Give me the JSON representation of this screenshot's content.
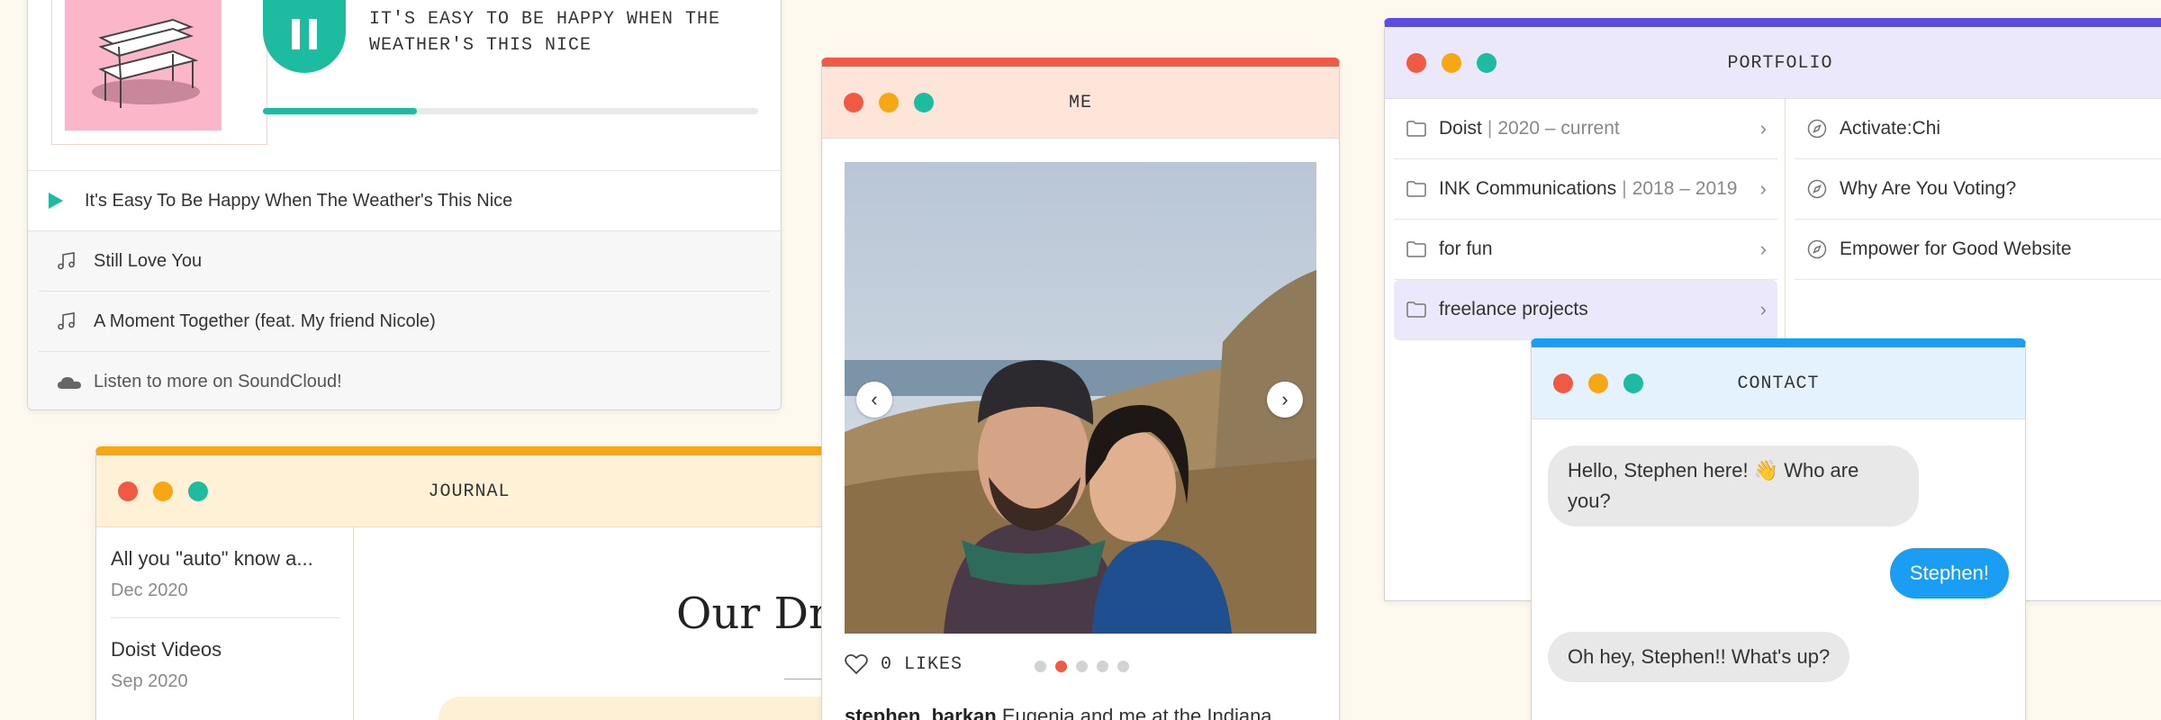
{
  "music": {
    "now_playing": "IT'S EASY TO BE HAPPY WHEN THE WEATHER'S THIS NICE",
    "progress": 0.31,
    "tracks": [
      {
        "label": "It's Easy To Be Happy When The Weather's This Nice",
        "icon": "play-icon",
        "active": true
      },
      {
        "label": "Still Love You",
        "icon": "music-note-icon"
      },
      {
        "label": "A Moment Together (feat. My friend Nicole)",
        "icon": "music-note-icon"
      }
    ],
    "soundcloud_label": "Listen to more on SoundCloud!"
  },
  "journal": {
    "title": "JOURNAL",
    "entries": [
      {
        "title": "All you \"auto\" know a...",
        "date": "Dec 2020"
      },
      {
        "title": "Doist Videos",
        "date": "Sep 2020"
      }
    ],
    "main_title": "Our Dnl"
  },
  "me": {
    "title": "ME",
    "likes": "0 LIKES",
    "pager": {
      "count": 5,
      "current": 2
    },
    "caption_user": "stephen_barkan",
    "caption_text": "Eugenia and me at the Indiana"
  },
  "portfolio": {
    "title": "PORTFOLIO",
    "folders": [
      {
        "name": "Doist",
        "sep": "|",
        "years": "2020 – current"
      },
      {
        "name": "INK Communications",
        "sep": "|",
        "years": "2018 – 2019"
      },
      {
        "name": "for fun",
        "sep": "",
        "years": ""
      },
      {
        "name": "freelance projects",
        "sep": "",
        "years": "",
        "selected": true
      }
    ],
    "projects": [
      "Activate:Chi",
      "Why Are You Voting?",
      "Empower for Good Website"
    ]
  },
  "contact": {
    "title": "CONTACT",
    "messages": [
      {
        "from": "them",
        "text": "Hello, Stephen here! 👋 Who are you?"
      },
      {
        "from": "me",
        "text": "Stephen!"
      },
      {
        "from": "them",
        "text": "Oh hey, Stephen!! What's up?"
      }
    ]
  },
  "colors": {
    "red": "#f05a44",
    "yellow": "#f7a712",
    "green": "#1dbb9f",
    "purple": "#5b4ce6",
    "blue": "#1a9ef3"
  }
}
